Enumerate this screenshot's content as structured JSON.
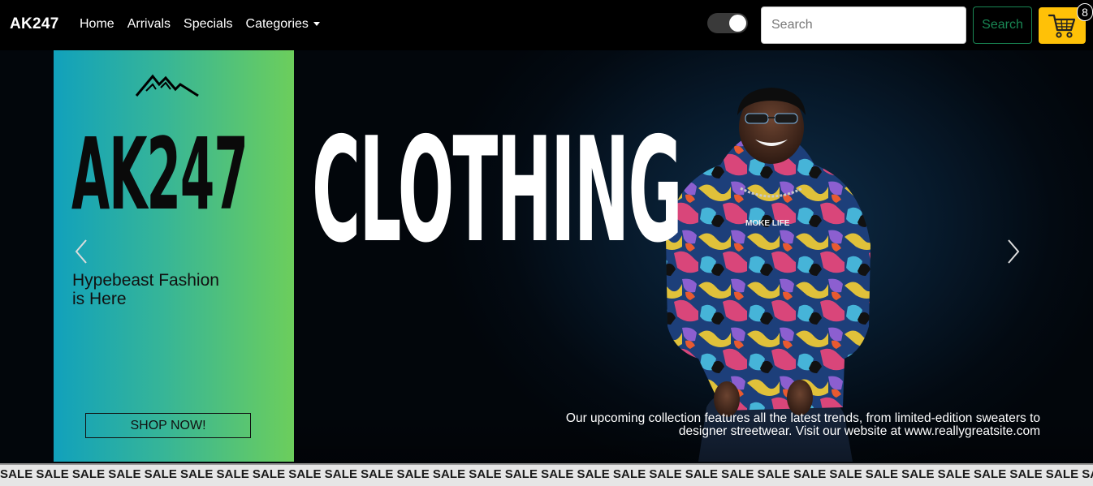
{
  "navbar": {
    "brand": "AK247",
    "links": [
      "Home",
      "Arrivals",
      "Specials",
      "Categories"
    ],
    "search": {
      "placeholder": "Search",
      "button_label": "Search"
    },
    "cart": {
      "count": "8"
    },
    "colors": {
      "search_button": "#198754",
      "cart_button": "#ffc107"
    }
  },
  "hero": {
    "promo": {
      "brand": "AK247",
      "tagline": "Hypebeast Fashion is Here",
      "cta_label": "SHOP NOW!"
    },
    "title": "CLOTHING",
    "description": "Our upcoming collection features all the latest trends, from limited-edition sweaters to designer streetwear. Visit our website at www.reallygreatsite.com",
    "hoodie_print": "MOKE LIFE"
  },
  "sale_strip": {
    "word": "SALE"
  }
}
